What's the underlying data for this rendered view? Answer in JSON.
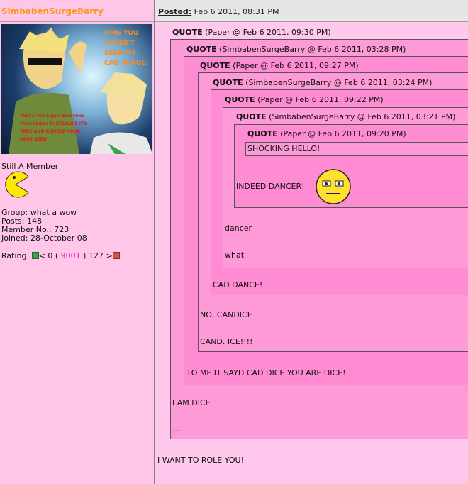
{
  "header": {
    "username": "SimbabenSurgeBarry",
    "posted_label": "Posted:",
    "posted_date": "Feb 6 2011, 08:31 PM"
  },
  "user": {
    "avatar_text_top": [
      "OMG YOU",
      "HAVEN'T",
      "SEEN MY",
      "CAD SURGE!"
    ],
    "avatar_text_bottom": [
      "That's The Sayin' Everyone",
      "Most Listen To BECAUSE ITS",
      "TRUE AND REMBER YOUR",
      "HAVE BEEN"
    ],
    "member_title": "Still A Member",
    "group": "Group: what a wow",
    "posts": "Posts: 148",
    "member_no": "Member No.: 723",
    "joined": "Joined: 28-October 08",
    "rating_label": "Rating:",
    "rating_low": "< 0 (",
    "rating_value": "9001",
    "rating_high": ") 127 >"
  },
  "quotes": [
    {
      "label": "QUOTE",
      "meta": "(Paper @ Feb 6 2011, 09:30 PM)"
    },
    {
      "label": "QUOTE",
      "meta": "(SimbabenSurgeBarry @ Feb 6 2011, 03:28 PM)"
    },
    {
      "label": "QUOTE",
      "meta": "(Paper @ Feb 6 2011, 09:27 PM)"
    },
    {
      "label": "QUOTE",
      "meta": "(SimbabenSurgeBarry @ Feb 6 2011, 03:24 PM)"
    },
    {
      "label": "QUOTE",
      "meta": "(Paper @ Feb 6 2011, 09:22 PM)"
    },
    {
      "label": "QUOTE",
      "meta": "(SimbabenSurgeBarry @ Feb 6 2011, 03:21 PM)"
    },
    {
      "label": "QUOTE",
      "meta": "(Paper @ Feb 6 2011, 09:20 PM)"
    }
  ],
  "texts": {
    "shocking": "SHOCKING HELLO!",
    "indeed": "INDEED DANCER!",
    "dancer": "dancer",
    "what": "what",
    "cad_dance": "CAD DANCE!",
    "no_candice": "NO, CANDICE",
    "cand_ice": "CAND. ICE!!!!",
    "to_me": "TO ME IT SAYD CAD DICE YOU ARE DICE!",
    "i_am_dice": "I AM DICE",
    "ellipsis": "...",
    "i_want": "I WANT TO ROLE YOU!"
  },
  "colors": {
    "username": "#f59a1a",
    "rating_value": "#d020c0",
    "rating_plus": "#3aa34a",
    "rating_minus": "#cc5544"
  }
}
